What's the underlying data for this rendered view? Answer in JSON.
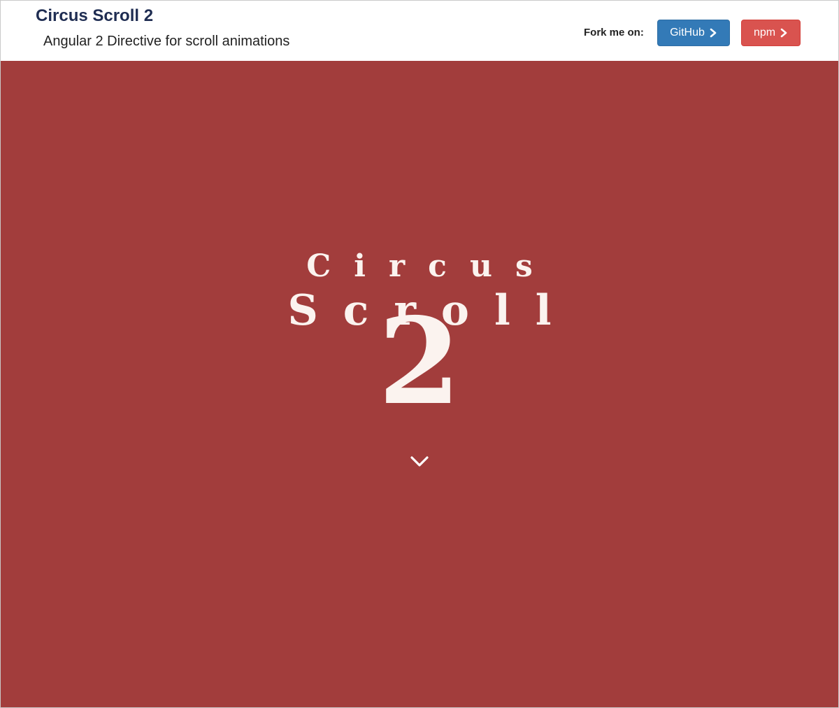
{
  "header": {
    "title": "Circus Scroll 2",
    "subtitle": "Angular 2 Directive for scroll animations",
    "fork_label": "Fork me on:",
    "buttons": [
      {
        "label": "GitHub",
        "icon": "chevron-right-icon",
        "color": "#337ab7"
      },
      {
        "label": "npm",
        "icon": "chevron-right-icon",
        "color": "#d9534f"
      }
    ]
  },
  "hero": {
    "background_color": "#a23d3c",
    "logo": {
      "line1": "Circus",
      "line2": "Scroll",
      "number": "2"
    },
    "scroll_icon": "chevron-down-icon"
  }
}
